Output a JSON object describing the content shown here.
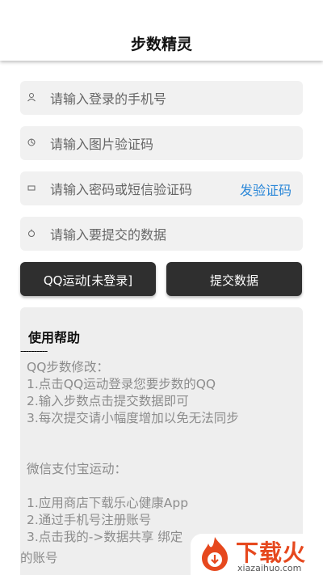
{
  "app": {
    "title": "步数精灵"
  },
  "form": {
    "phone_placeholder": "请输入登录的手机号",
    "captcha_placeholder": "请输入图片验证码",
    "password_placeholder": "请输入密码或短信验证码",
    "send_code_label": "发验证码",
    "steps_placeholder": "请输入要提交的数据"
  },
  "buttons": {
    "qq_label": "QQ运动[未登录]",
    "submit_label": "提交数据"
  },
  "help": {
    "title": "使用帮助",
    "divider": "----------",
    "lines": [
      "QQ步数修改：",
      "1.点击QQ运动登录您要步数的QQ",
      "2.输入步数点击提交数据即可",
      "3.每次提交请小幅度增加以免无法同步",
      "",
      "",
      "微信支付宝运动：",
      "",
      "1.应用商店下载乐心健康App",
      "2.通过手机号注册账号",
      "3.点击我的->数据共享 绑定"
    ],
    "overflow_line": "的账号"
  },
  "watermark": {
    "name": "下载火",
    "domain": "xiazaihuo.com"
  },
  "colors": {
    "accent": "#2a87d8",
    "button_bg": "#2f2f2f",
    "field_bg": "#f1f1f1",
    "watermark": "#e6481e"
  }
}
